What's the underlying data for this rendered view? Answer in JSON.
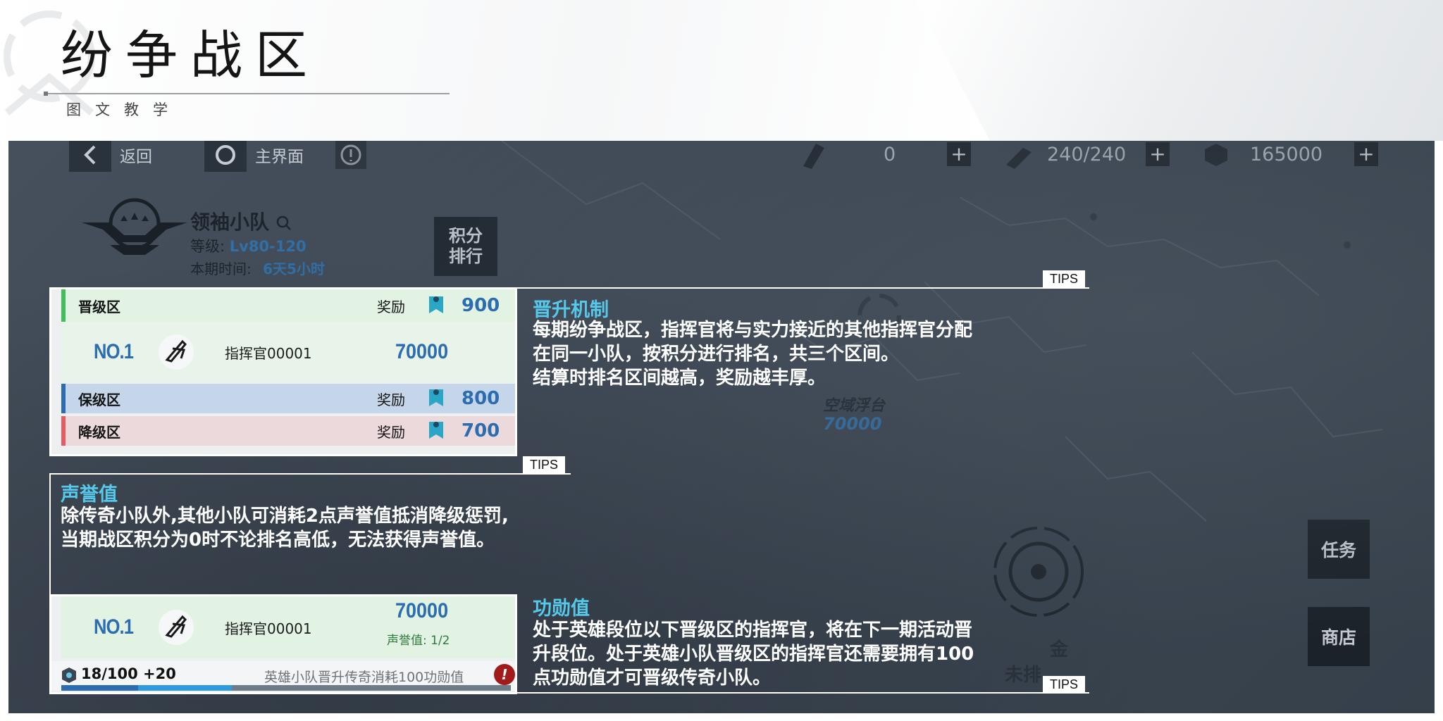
{
  "header": {
    "title": "纷争战区",
    "subtitle": "图文教学"
  },
  "topbar": {
    "back_label": "返回",
    "home_label": "主界面",
    "resources": [
      "0",
      "240/240",
      "165000"
    ]
  },
  "squad": {
    "name": "领袖小队",
    "level_label": "等级:",
    "level_value": "Lv80-120",
    "time_label": "本期时间:",
    "time_value": "6天5小时",
    "rank_button": [
      "积分",
      "排行"
    ]
  },
  "zones": [
    {
      "label": "晋级区",
      "reward_label": "奖励",
      "reward": "900",
      "color": "#3fbf5a"
    },
    {
      "label": "保级区",
      "reward_label": "奖励",
      "reward": "800",
      "color": "#2b6db0"
    },
    {
      "label": "降级区",
      "reward_label": "奖励",
      "reward": "700",
      "color": "#e85b63"
    }
  ],
  "ranking_row": {
    "rank": "NO.1",
    "commander": "指挥官00001",
    "score": "70000"
  },
  "ranking_row2": {
    "rank": "NO.1",
    "commander": "指挥官00001",
    "score": "70000",
    "reputation": "声誉值: 1/2"
  },
  "merit": {
    "value": "18/100 +20",
    "note": "英雄小队晋升传奇消耗100功勋值",
    "alert": "!",
    "progress_percent": 0.38
  },
  "map": {
    "location_name": "空域浮台",
    "location_score": "70000",
    "partial_text_1": "金",
    "partial_text_2": "未排"
  },
  "side_buttons": {
    "task": "任务",
    "shop": "商店"
  },
  "tips": {
    "tag": "TIPS",
    "promotion": {
      "title": "晋升机制",
      "lines": [
        "每期纷争战区，指挥官将与实力接近的其他指挥官分配",
        "在同一小队，按积分进行排名，共三个区间。",
        "结算时排名区间越高，奖励越丰厚。"
      ]
    },
    "reputation": {
      "title": "声誉值",
      "lines": [
        "除传奇小队外,其他小队可消耗2点声誉值抵消降级惩罚,",
        "当期战区积分为0时不论排名高低，无法获得声誉值。"
      ]
    },
    "merit": {
      "title": "功勋值",
      "lines": [
        "处于英雄段位以下晋级区的指挥官，将在下一期活动晋",
        "升段位。处于英雄小队晋级区的指挥官还需要拥有100",
        "点功勋值才可晋级传奇小队。"
      ]
    }
  },
  "colors": {
    "accent": "#56c8ea",
    "score_blue": "#2b6db0",
    "promo_green": "#e2f3e4",
    "keep_blue": "#c6d6ea",
    "demote_red": "#ebd9dc"
  }
}
